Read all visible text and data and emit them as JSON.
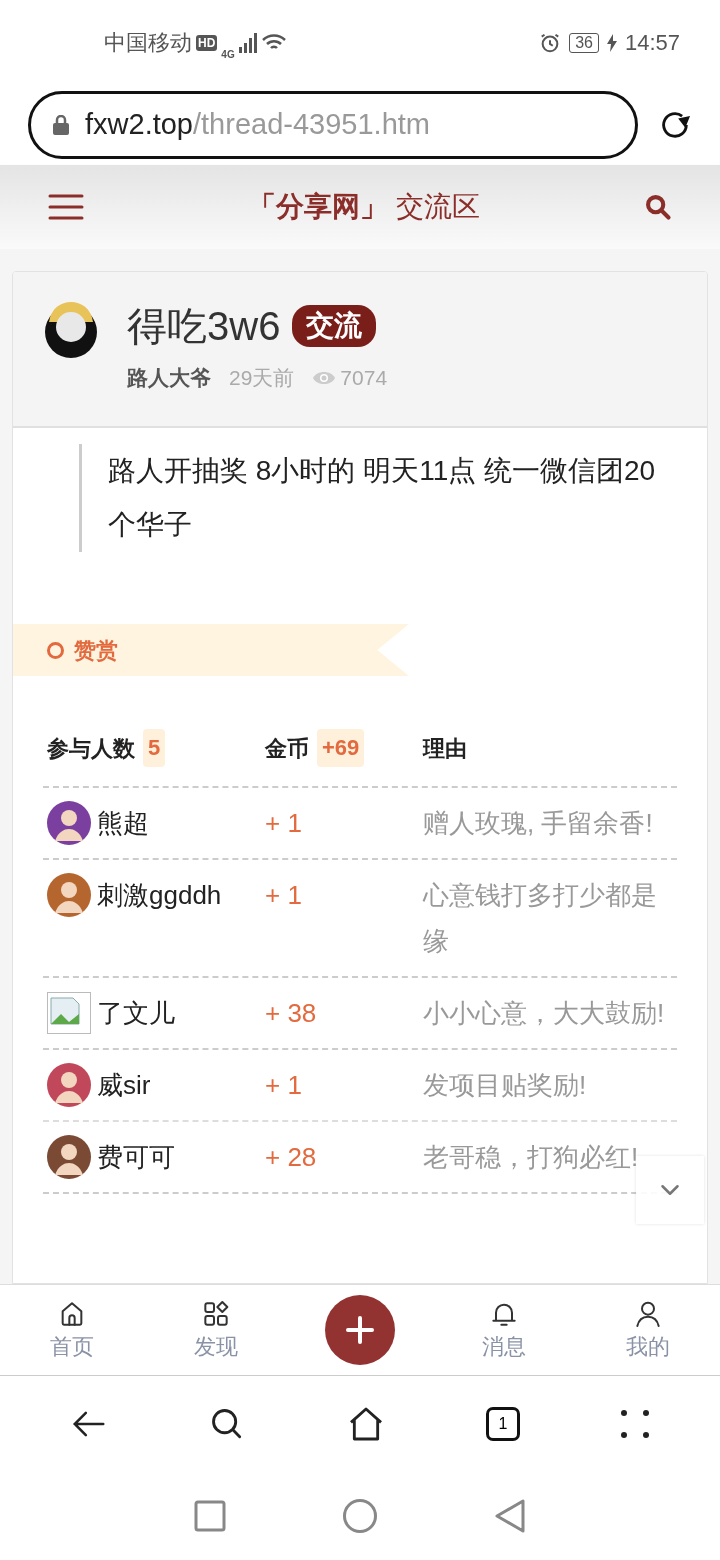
{
  "status_bar": {
    "carrier": "中国移动",
    "hd": "HD",
    "network": "4G",
    "battery": "36",
    "time": "14:57"
  },
  "address_bar": {
    "domain": "fxw2.top",
    "path": "/thread-43951.htm"
  },
  "site_header": {
    "brand": "「分享网」",
    "section": "交流区"
  },
  "post": {
    "title": "得吃3w6",
    "tag": "交流",
    "author": "路人大爷",
    "time": "29天前",
    "views": "7074",
    "body": "路人开抽奖 8小时的 明天11点 统一微信团20个华子"
  },
  "reward": {
    "title": "赞赏",
    "columns": [
      {
        "label": "参与人数",
        "count": "5"
      },
      {
        "label": "金币",
        "count": "+69"
      },
      {
        "label": "理由"
      }
    ],
    "rows": [
      {
        "kind": "avatar",
        "color": "#7b3fa0",
        "name": "熊超",
        "coins": "+ 1",
        "reason": "赠人玫瑰, 手留余香!"
      },
      {
        "kind": "avatar",
        "color": "#b5652e",
        "name": "刺激ggddh",
        "coins": "+ 1",
        "reason": "心意钱打多打少都是缘"
      },
      {
        "kind": "broken-image",
        "name": "了文儿",
        "coins": "+ 38",
        "reason": "小小心意，大大鼓励!"
      },
      {
        "kind": "avatar",
        "color": "#c0485a",
        "name": "威sir",
        "coins": "+ 1",
        "reason": "发项目贴奖励!"
      },
      {
        "kind": "avatar",
        "color": "#7a4a34",
        "name": "费可可",
        "coins": "+ 28",
        "reason": "老哥稳，打狗必红!"
      }
    ]
  },
  "bottom_nav": [
    {
      "kind": "home",
      "label": "首页"
    },
    {
      "kind": "discover",
      "label": "发现"
    },
    {
      "kind": "add"
    },
    {
      "kind": "bell",
      "label": "消息"
    },
    {
      "kind": "user",
      "label": "我的"
    }
  ],
  "browser_toolbar": {
    "tab_count": "1"
  }
}
